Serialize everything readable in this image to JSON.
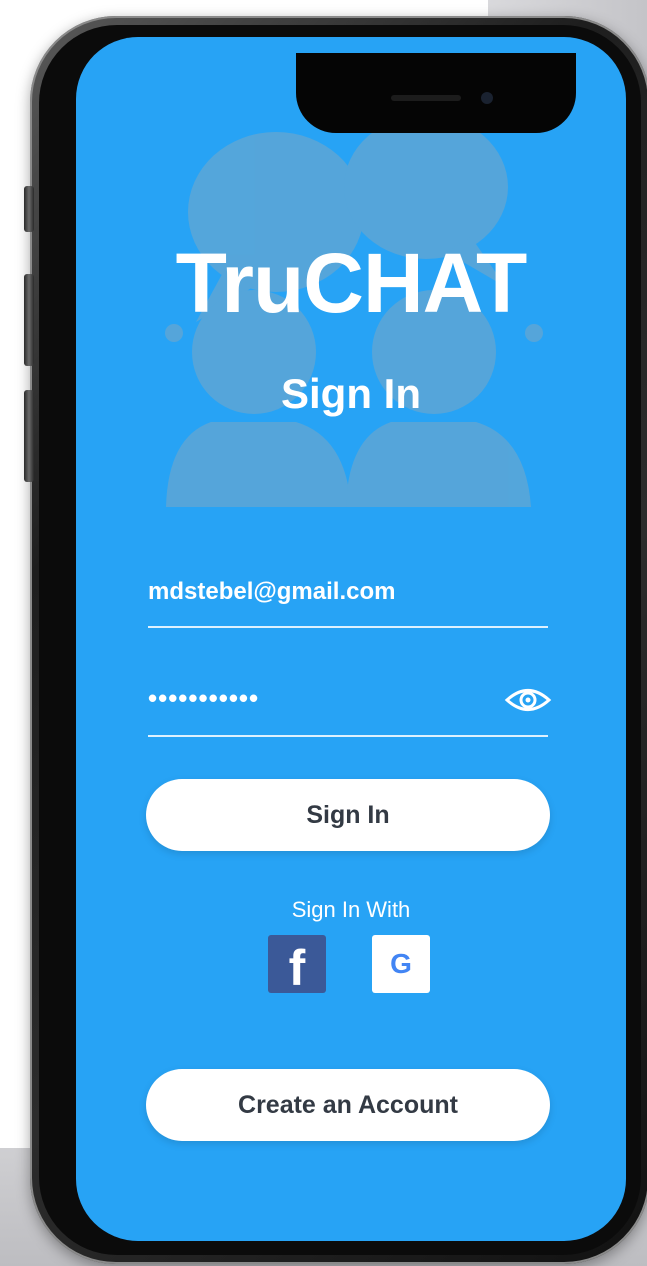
{
  "app": {
    "title": "TruCHAT",
    "page_title": "Sign In"
  },
  "form": {
    "email_value": "mdstebel@gmail.com",
    "password_value": "•••••••••••",
    "show_password_icon": "eye-icon"
  },
  "actions": {
    "sign_in_label": "Sign In",
    "sign_in_with_label": "Sign In With",
    "facebook_glyph": "f",
    "google_glyph": "G",
    "create_account_label": "Create an Account"
  },
  "colors": {
    "screen_background": "#27a3f5",
    "illustration": "#5aa6d8",
    "button_background": "#ffffff",
    "button_text": "#333a44",
    "facebook": "#3b5998",
    "google": "#4285f4"
  }
}
